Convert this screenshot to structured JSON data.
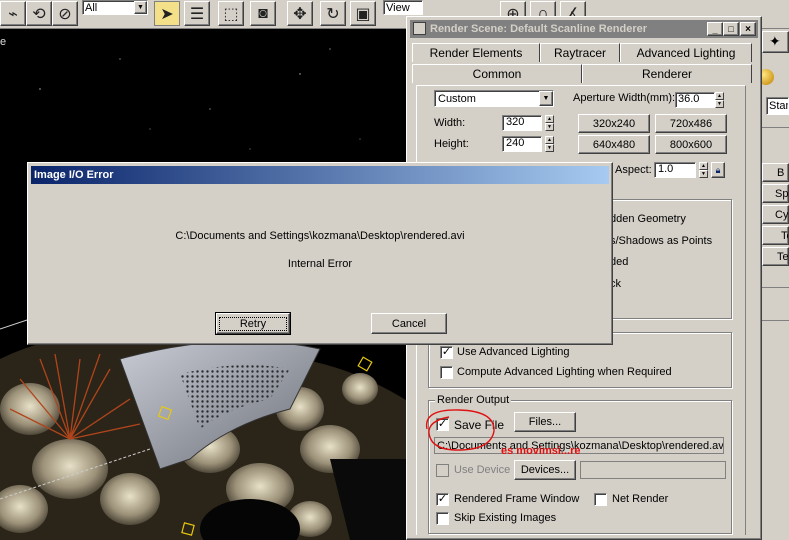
{
  "toolbar": {
    "selection_filter": "All",
    "coord_system": "View"
  },
  "viewport": {
    "label": "e"
  },
  "render_scene": {
    "title": "Render Scene: Default Scanline Renderer",
    "tabs_row1": [
      "Render Elements",
      "Raytracer",
      "Advanced Lighting"
    ],
    "tabs_row2": [
      "Common",
      "Renderer"
    ],
    "output_size": {
      "preset": "Custom",
      "aperture_label": "Aperture Width(mm):",
      "aperture_value": "36.0",
      "width_label": "Width:",
      "width_value": "320",
      "height_label": "Height:",
      "height_value": "240",
      "presets": [
        "320x240",
        "720x486",
        "640x480",
        "800x600"
      ],
      "aspect_label": "Aspect:",
      "aspect_value": "1.0"
    },
    "options": [
      "dden Geometry",
      "s/Shadows as Points",
      "ded",
      "ck"
    ],
    "advanced_lighting": {
      "use": "Use Advanced Lighting",
      "use_checked": true,
      "compute": "Compute Advanced Lighting when Required",
      "compute_checked": false
    },
    "render_output": {
      "group_label": "Render Output",
      "save_file_label": "Save File",
      "save_file_checked": true,
      "files_button": "Files...",
      "path": "C:\\Documents and Settings\\kozmana\\Desktop\\rendered.avi",
      "use_device_label": "Use Device",
      "devices_button": "Devices...",
      "device_value": "",
      "rendered_frame_window": "Rendered Frame Window",
      "rendered_frame_checked": true,
      "net_render": "Net Render",
      "net_render_checked": false,
      "skip_existing": "Skip Existing Images",
      "skip_existing_checked": false
    },
    "annotation": "es movimsi...re"
  },
  "cmd_panel": {
    "items": [
      "Stan",
      "B",
      "Sp",
      "Cyl",
      "Te",
      "Te"
    ]
  },
  "error_dialog": {
    "title": "Image I/O Error",
    "path": "C:\\Documents and Settings\\kozmana\\Desktop\\rendered.avi",
    "message": "Internal Error",
    "retry_button": "Retry",
    "cancel_button": "Cancel"
  },
  "colors": {
    "face": "#d4d0c8",
    "active_title_start": "#0a246a",
    "active_title_end": "#a6caf0",
    "inactive_title": "#808080",
    "annotation_red": "#e01010"
  }
}
